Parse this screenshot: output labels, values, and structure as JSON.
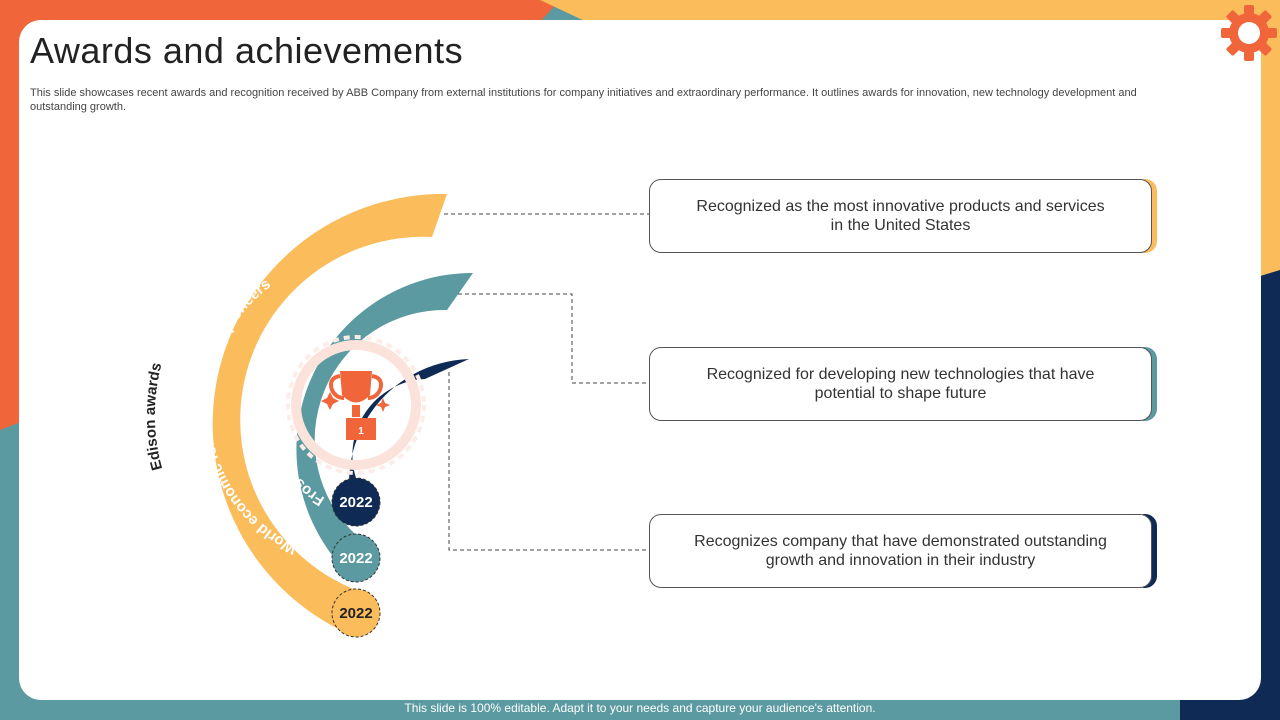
{
  "title": "Awards and achievements",
  "subtitle": "This slide showcases recent awards and recognition received by ABB  Company from external institutions for company initiatives and extraordinary performance. It outlines awards for innovation, new technology development and outstanding growth.",
  "arcs": [
    {
      "label": "Edison awards",
      "year": "2022",
      "color": "#FBBC5C",
      "label_color": "#222222"
    },
    {
      "label": "World economic forum technology pioneers",
      "year": "2022",
      "color": "#5B9AA0",
      "label_color": "#ffffff"
    },
    {
      "label": "Frost & Sullivan Global Growth",
      "year": "2022",
      "color": "#0E2A55",
      "label_color": "#ffffff"
    }
  ],
  "callouts": [
    {
      "text": "Recognized as the most innovative products and services in the United States",
      "accent": "#FBBC5C"
    },
    {
      "text": "Recognized for developing new technologies that have potential to shape future",
      "accent": "#5B9AA0"
    },
    {
      "text": "Recognizes company that have demonstrated outstanding growth and innovation in their industry",
      "accent": "#0E2A55"
    }
  ],
  "trophy": {
    "label": "1",
    "color": "#F0653A"
  },
  "footer": "This slide is 100% editable. Adapt it to your needs and capture your audience's attention.",
  "colors": {
    "orange": "#F0653A",
    "yellow": "#FBBC5C",
    "teal": "#5B9AA0",
    "navy": "#0E2A55"
  }
}
